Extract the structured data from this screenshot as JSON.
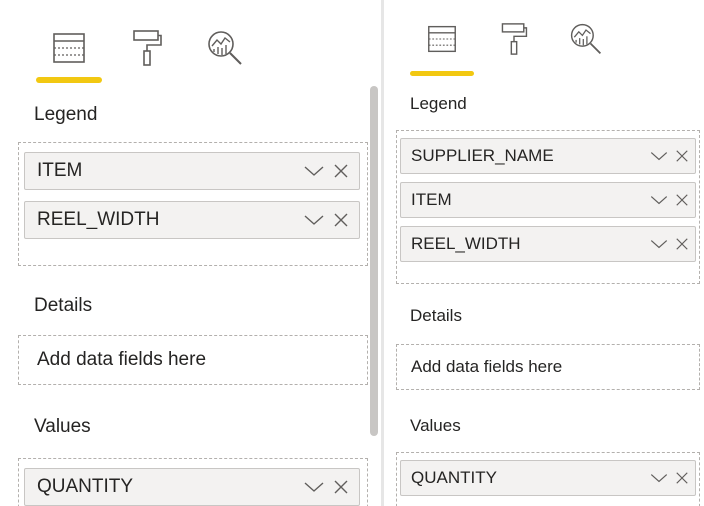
{
  "left_pane": {
    "tabs": [
      {
        "icon": "fields-icon",
        "active": true
      },
      {
        "icon": "format-paint-roller-icon",
        "active": false
      },
      {
        "icon": "analytics-magnifier-icon",
        "active": false
      }
    ],
    "legend_label": "Legend",
    "legend_fields": [
      "ITEM",
      "REEL_WIDTH"
    ],
    "details_label": "Details",
    "details_placeholder": "Add data fields here",
    "values_label": "Values",
    "values_fields": [
      "QUANTITY"
    ]
  },
  "right_pane": {
    "tabs": [
      {
        "icon": "fields-icon",
        "active": true
      },
      {
        "icon": "format-paint-roller-icon",
        "active": false
      },
      {
        "icon": "analytics-magnifier-icon",
        "active": false
      }
    ],
    "legend_label": "Legend",
    "legend_fields": [
      "SUPPLIER_NAME",
      "ITEM",
      "REEL_WIDTH"
    ],
    "details_label": "Details",
    "details_placeholder": "Add data fields here",
    "values_label": "Values",
    "values_fields": [
      "QUANTITY"
    ]
  },
  "colors": {
    "accent_underline": "#f2c811",
    "field_bg": "#f3f2f1",
    "well_border": "#b3b0ad",
    "text": "#252423"
  }
}
